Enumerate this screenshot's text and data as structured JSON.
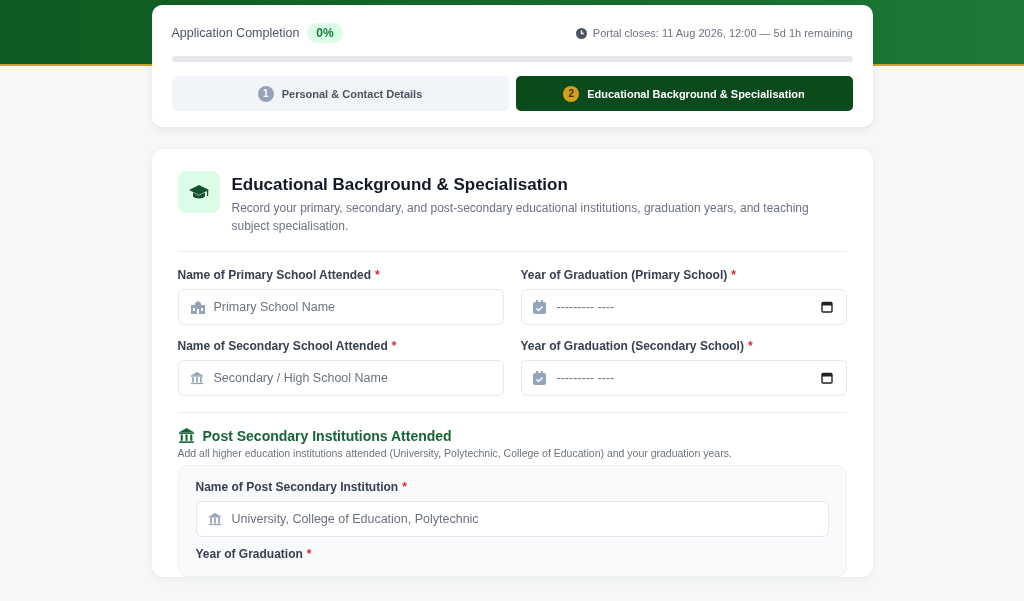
{
  "progress": {
    "label": "Application Completion",
    "percent": "0%",
    "deadline": "Portal closes: 11 Aug 2026, 12:00 — 5d 1h remaining",
    "level": 0
  },
  "steps": [
    {
      "number": "1",
      "label": "Personal & Contact Details",
      "selected": false
    },
    {
      "number": "2",
      "label": "Educational Background & Specialisation",
      "selected": true
    }
  ],
  "section": {
    "title": "Educational Background & Specialisation",
    "description": "Record your primary, secondary, and post-secondary educational institutions, graduation years, and teaching subject specialisation."
  },
  "fields": [
    {
      "kind": "text",
      "label": "Name of Primary School Attended",
      "required_mark": "*",
      "placeholder": "Primary School Name"
    },
    {
      "kind": "date",
      "label": "Year of Graduation (Primary School)",
      "required_mark": "*",
      "placeholder": "--------- ----"
    },
    {
      "kind": "text",
      "label": "Name of Secondary School Attended",
      "required_mark": "*",
      "placeholder": "Secondary / High School Name"
    },
    {
      "kind": "date",
      "label": "Year of Graduation (Secondary School)",
      "required_mark": "*",
      "placeholder": "--------- ----"
    }
  ],
  "post_secondary": {
    "title": "Post Secondary Institutions Attended",
    "description": "Add all higher education institutions attended (University, Polytechnic, College of Education) and your graduation years.",
    "fields": [
      {
        "kind": "text",
        "label": "Name of Post Secondary Institution",
        "required_mark": "*",
        "placeholder": "University, College of Education, Polytechnic"
      },
      {
        "kind": "label",
        "label": "Year of Graduation",
        "required_mark": "*"
      }
    ]
  }
}
